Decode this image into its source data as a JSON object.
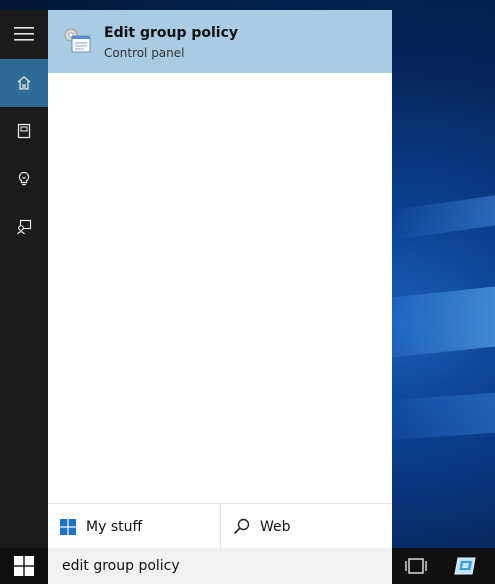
{
  "rail": {
    "items": [
      {
        "icon": "hamburger-menu-icon"
      },
      {
        "icon": "home-icon",
        "active": true
      },
      {
        "icon": "notebook-icon"
      },
      {
        "icon": "lightbulb-icon"
      },
      {
        "icon": "feedback-icon"
      }
    ]
  },
  "result": {
    "title": "Edit group policy",
    "subtitle": "Control panel",
    "icon": "group-policy-icon",
    "highlight_color": "#a9cce3"
  },
  "scopes": {
    "my_stuff_label": "My stuff",
    "web_label": "Web"
  },
  "search": {
    "value": "edit group policy"
  },
  "taskbar": {
    "start_icon": "windows-logo-icon",
    "task_view_icon": "task-view-icon",
    "pinned_app_icon": "app-icon"
  },
  "colors": {
    "rail_bg": "#1b1b1b",
    "rail_active": "#2e6b94",
    "taskbar_bg": "#101010",
    "searchbox_bg": "#f2f2f2"
  }
}
